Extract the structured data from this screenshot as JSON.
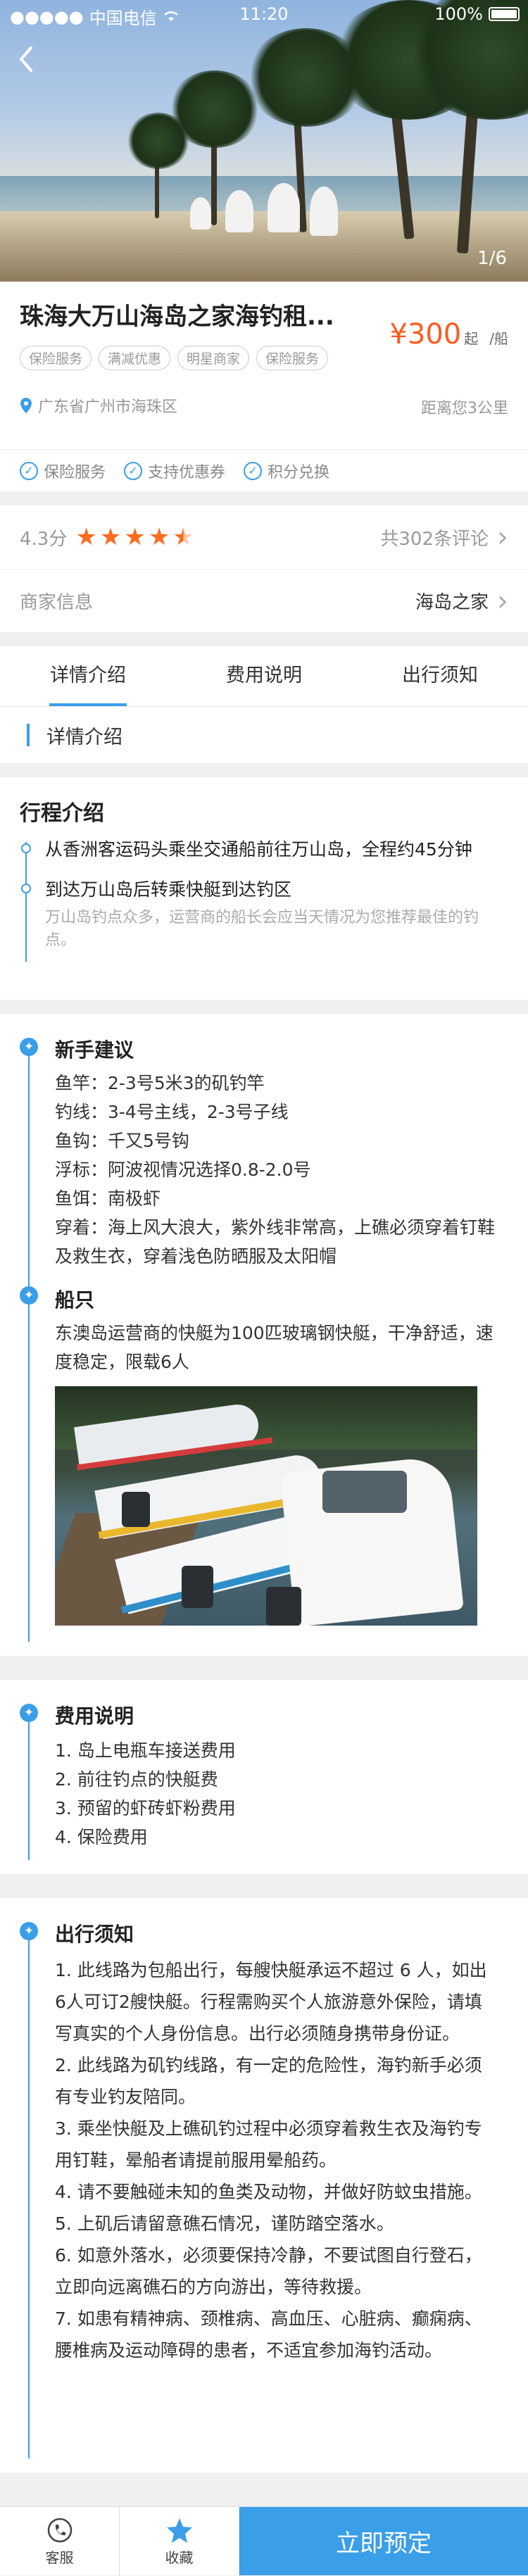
{
  "status_bar": {
    "carrier": "中国电信",
    "time": "11:20",
    "battery": "100%"
  },
  "hero": {
    "pager": "1/6"
  },
  "product": {
    "title": "珠海大万山海岛之家海钓租...",
    "price": "¥300",
    "price_suffix_1": "起",
    "price_suffix_2": "/船",
    "tags": [
      "保险服务",
      "满减优惠",
      "明星商家",
      "保险服务"
    ],
    "location": "广东省广州市海珠区",
    "distance": "距离您3公里"
  },
  "services": [
    "保险服务",
    "支持优惠券",
    "积分兑换"
  ],
  "rating": {
    "score_text": "4.3分",
    "stars": 4.5,
    "reviews": "共302条评论"
  },
  "merchant": {
    "label": "商家信息",
    "name": "海岛之家"
  },
  "tabs": [
    "详情介绍",
    "费用说明",
    "出行须知"
  ],
  "detail_subhead": "详情介绍",
  "itinerary": {
    "title": "行程介绍",
    "items": [
      {
        "text": "从香洲客运码头乘坐交通船前往万山岛，全程约45分钟",
        "note": ""
      },
      {
        "text": "到达万山岛后转乘快艇到达钓区",
        "note": "万山岛钓点众多，运营商的船长会应当天情况为您推荐最佳的钓点。"
      }
    ]
  },
  "tips": {
    "title": "新手建议",
    "lines": [
      "鱼竿：2-3号5米3的矶钓竿",
      "钓线：3-4号主线，2-3号子线",
      "鱼钩：千又5号钩",
      "浮标：阿波视情况选择0.8-2.0号",
      "鱼饵：南极虾",
      "穿着：海上风大浪大，紫外线非常高，上礁必须穿着钉鞋及救生衣，穿着浅色防晒服及太阳帽"
    ]
  },
  "boat": {
    "title": "船只",
    "desc": "东澳岛运营商的快艇为100匹玻璃钢快艇，干净舒适，速度稳定，限载6人"
  },
  "fees": {
    "title": "费用说明",
    "items": [
      "1.  岛上电瓶车接送费用",
      "2.  前往钓点的快艇费",
      "3.  预留的虾砖虾粉费用",
      "4.  保险费用"
    ]
  },
  "notice": {
    "title": "出行须知",
    "items": [
      "1. 此线路为包船出行，每艘快艇承运不超过 6 人，如出6人可订2艘快艇。行程需购买个人旅游意外保险，请填写真实的个人身份信息。出行必须随身携带身份证。",
      "2. 此线路为矶钓线路，有一定的危险性，海钓新手必须有专业钓友陪同。",
      "3. 乘坐快艇及上礁矶钓过程中必须穿着救生衣及海钓专用钉鞋，晕船者请提前服用晕船药。",
      "4. 请不要触碰未知的鱼类及动物，并做好防蚊虫措施。",
      "5. 上矶后请留意礁石情况，谨防踏空落水。",
      "6. 如意外落水，必须要保持冷静，不要试图自行登石，立即向远离礁石的方向游出，等待救援。",
      "7. 如患有精神病、颈椎病、高血压、心脏病、癫痫病、腰椎病及运动障碍的患者，不适宜参加海钓活动。"
    ]
  },
  "bottom_bar": {
    "service": "客服",
    "favorite": "收藏",
    "book": "立即预定"
  },
  "colors": {
    "accent": "#3a9ee8",
    "price": "#ff5a1f",
    "star": "#ff6b1f"
  }
}
